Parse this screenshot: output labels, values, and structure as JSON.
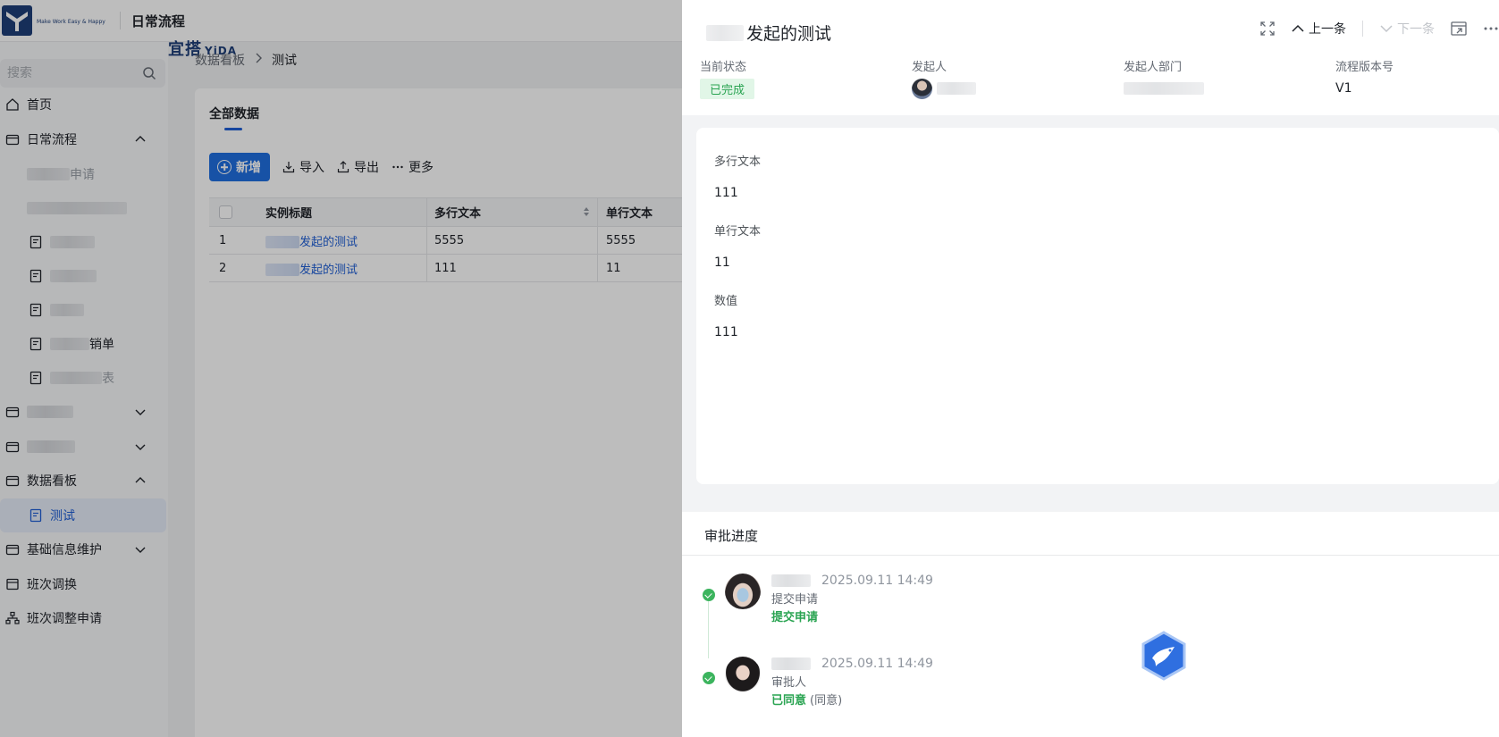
{
  "app": {
    "logo_cn": "宜搭",
    "logo_en": "YiDA",
    "logo_tagline": "Make Work Easy & Happy",
    "name": "日常流程"
  },
  "sidebar": {
    "search_placeholder": "搜索",
    "items": [
      {
        "label": "首页",
        "icon": "home-icon"
      },
      {
        "label": "日常流程",
        "icon": "folder-icon",
        "expanded": true
      },
      {
        "label": "数据看板",
        "icon": "folder-icon",
        "expanded": true
      },
      {
        "label": "测试",
        "icon": "report-icon",
        "active": true
      },
      {
        "label": "基础信息维护",
        "icon": "folder-icon",
        "expanded": false
      },
      {
        "label": "班次调换",
        "icon": "form-icon"
      },
      {
        "label": "班次调整申请",
        "icon": "org-icon"
      }
    ],
    "partial_labels": [
      "申请",
      "销单",
      "表"
    ]
  },
  "breadcrumb": {
    "parent": "数据看板",
    "current": "测试"
  },
  "main": {
    "tab": "全部数据",
    "toolbar": {
      "add": "新增",
      "import": "导入",
      "export": "导出",
      "more": "更多"
    },
    "columns": [
      "实例标题",
      "多行文本",
      "单行文本"
    ],
    "rows": [
      {
        "index": "1",
        "title": "发起的测试",
        "multi": "5555",
        "single": "5555"
      },
      {
        "index": "2",
        "title": "发起的测试",
        "multi": "111",
        "single": "11"
      }
    ]
  },
  "drawer": {
    "title": "发起的测试",
    "actions": {
      "prev": "上一条",
      "next": "下一条"
    },
    "meta": {
      "status_label": "当前状态",
      "status_value": "已完成",
      "initiator_label": "发起人",
      "dept_label": "发起人部门",
      "version_label": "流程版本号",
      "version_value": "V1"
    },
    "fields": [
      {
        "label": "多行文本",
        "value": "111"
      },
      {
        "label": "单行文本",
        "value": "11"
      },
      {
        "label": "数值",
        "value": "111"
      }
    ],
    "progress": {
      "title": "审批进度",
      "steps": [
        {
          "time": "2025.09.11 14:49",
          "role": "提交申请",
          "result": "提交申请",
          "note": ""
        },
        {
          "time": "2025.09.11 14:49",
          "role": "审批人",
          "result": "已同意",
          "note": "(同意)"
        }
      ]
    }
  },
  "colors": {
    "primary": "#1f6fe0",
    "success": "#2aa452",
    "brand": "#1e3e78"
  }
}
